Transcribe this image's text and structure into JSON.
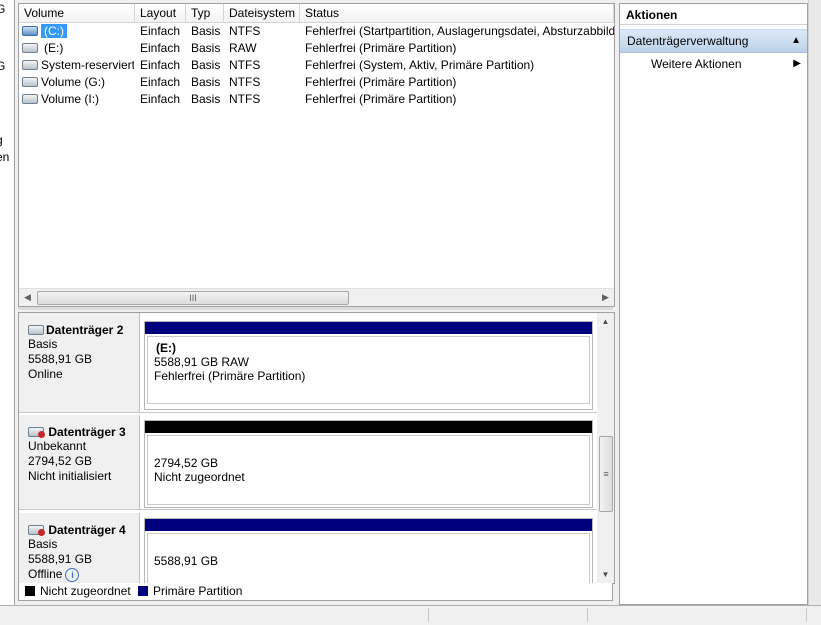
{
  "left_strip": {
    "fragments": [
      "G",
      "G",
      "g",
      "en"
    ]
  },
  "volume_list": {
    "columns": [
      "Volume",
      "Layout",
      "Typ",
      "Dateisystem",
      "Status"
    ],
    "rows": [
      {
        "volume": "(C:)",
        "layout": "Einfach",
        "typ": "Basis",
        "fs": "NTFS",
        "status": "Fehlerfrei (Startpartition, Auslagerungsdatei, Absturzabbild",
        "selected": true,
        "icon": "drive-blue-icon"
      },
      {
        "volume": "(E:)",
        "layout": "Einfach",
        "typ": "Basis",
        "fs": "RAW",
        "status": "Fehlerfrei (Primäre Partition)",
        "selected": false,
        "icon": "drive-icon"
      },
      {
        "volume": "System-reserviert",
        "layout": "Einfach",
        "typ": "Basis",
        "fs": "NTFS",
        "status": "Fehlerfrei (System, Aktiv, Primäre Partition)",
        "selected": false,
        "icon": "drive-icon"
      },
      {
        "volume": "Volume (G:)",
        "layout": "Einfach",
        "typ": "Basis",
        "fs": "NTFS",
        "status": "Fehlerfrei (Primäre Partition)",
        "selected": false,
        "icon": "drive-icon"
      },
      {
        "volume": "Volume (I:)",
        "layout": "Einfach",
        "typ": "Basis",
        "fs": "NTFS",
        "status": "Fehlerfrei (Primäre Partition)",
        "selected": false,
        "icon": "drive-icon"
      }
    ],
    "hscroll_grip": "III"
  },
  "disks": [
    {
      "name": "Datenträger 2",
      "type": "Basis",
      "size": "5588,91 GB",
      "state": "Online",
      "partition_label": "(E:)",
      "partition_size": "5588,91 GB RAW",
      "partition_status": "Fehlerfrei (Primäre Partition)",
      "bar_color": "#00007f",
      "icon": "disk-icon"
    },
    {
      "name": "Datenträger 3",
      "type": "Unbekannt",
      "size": "2794,52 GB",
      "state": "Nicht initialisiert",
      "partition_label": "",
      "partition_size": "2794,52 GB",
      "partition_status": "Nicht zugeordnet",
      "bar_color": "#000000",
      "icon": "disk-error-icon"
    },
    {
      "name": "Datenträger 4",
      "type": "Basis",
      "size": "5588,91 GB",
      "state": "Offline",
      "partition_label": "",
      "partition_size": "5588,91 GB",
      "partition_status": "",
      "bar_color": "#00007f",
      "icon": "disk-error-icon"
    }
  ],
  "disk_vscroll_grip": "≡",
  "legend": [
    {
      "label": "Nicht zugeordnet",
      "color": "#000000"
    },
    {
      "label": "Primäre Partition",
      "color": "#00007f"
    }
  ],
  "actions": {
    "title": "Aktionen",
    "section": "Datenträgerverwaltung",
    "items": [
      "Weitere Aktionen"
    ]
  },
  "icons": {
    "info": "i",
    "arrow_left": "◀",
    "arrow_right": "▶",
    "arrow_up": "▲",
    "arrow_down": "▼",
    "collapse": "▲",
    "submenu": "▶"
  }
}
